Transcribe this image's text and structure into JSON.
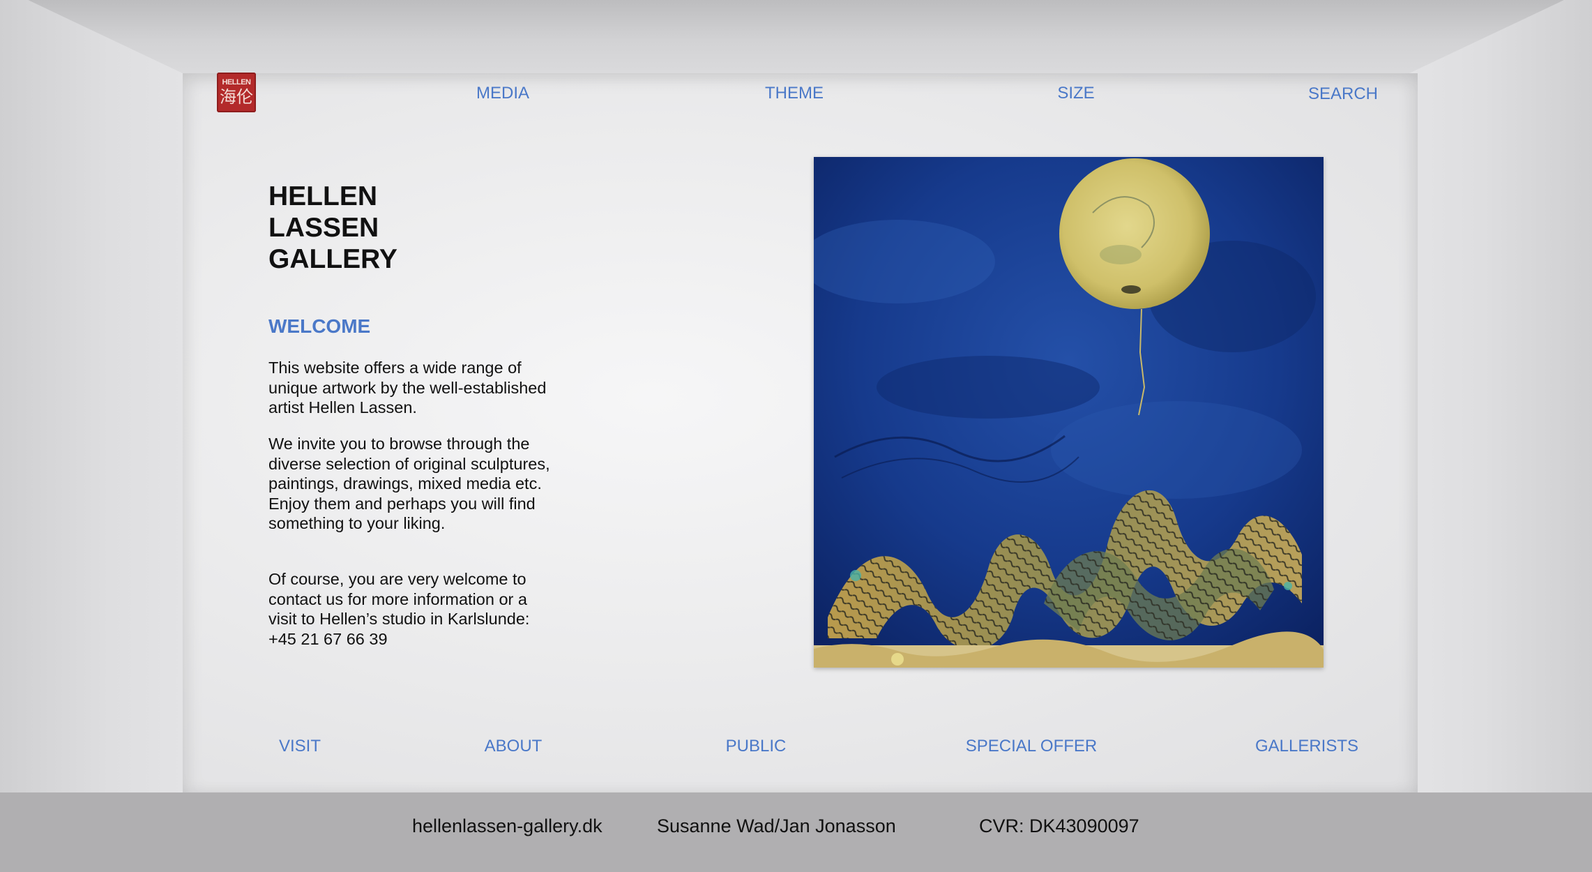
{
  "logo": {
    "line1": "HELLEN",
    "line2": "海伦"
  },
  "top_nav": [
    {
      "label": "MEDIA"
    },
    {
      "label": "THEME"
    },
    {
      "label": "SIZE"
    },
    {
      "label": "SEARCH"
    }
  ],
  "title": "HELLEN\nLASSEN\nGALLERY",
  "welcome_heading": "WELCOME",
  "paragraphs": [
    "This website offers a wide range of unique artwork by the well-established artist Hellen Lassen.",
    "We invite you to browse through the diverse selection of original sculptures, paintings, drawings, mixed media etc. Enjoy them and perhaps you will find something to your liking.",
    "Of course, you are very welcome to contact us for more information or a visit to Hellen’s studio in Karlslunde: +45 21 67 66 39"
  ],
  "bottom_nav": [
    {
      "label": "VISIT"
    },
    {
      "label": "ABOUT"
    },
    {
      "label": "PUBLIC"
    },
    {
      "label": "SPECIAL OFFER"
    },
    {
      "label": "GALLERISTS"
    }
  ],
  "footer": {
    "domain": "hellenlassen-gallery.dk",
    "names": "Susanne Wad/Jan Jonasson",
    "cvr": "CVR: DK43090097"
  },
  "colors": {
    "link": "#4a78c8",
    "seal": "#b32a2a",
    "footer_bg": "#b0afb1"
  }
}
